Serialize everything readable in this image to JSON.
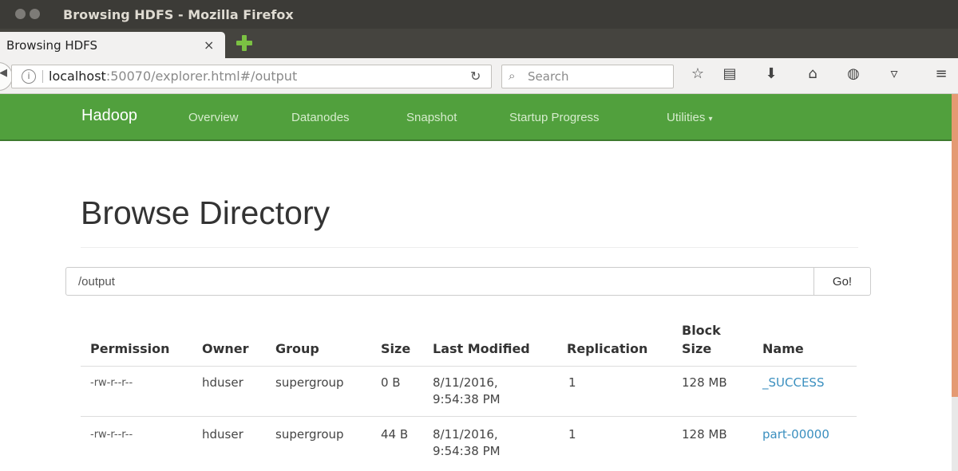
{
  "window": {
    "title": "Browsing HDFS - Mozilla Firefox"
  },
  "tab": {
    "label": "Browsing HDFS",
    "close": "×"
  },
  "navbar": {
    "url_host": "localhost",
    "url_rest": ":50070/explorer.html#/output",
    "search_placeholder": "Search"
  },
  "toolbar_icons": [
    "bookmark-star-icon",
    "reading-list-icon",
    "download-icon",
    "home-icon",
    "chat-icon",
    "pocket-icon",
    "menu-icon"
  ],
  "hadoop_nav": {
    "brand": "Hadoop",
    "links": [
      "Overview",
      "Datanodes",
      "Snapshot",
      "Startup Progress",
      "Utilities"
    ]
  },
  "main": {
    "title": "Browse Directory",
    "path_value": "/output",
    "go_label": "Go!",
    "columns": {
      "permission": "Permission",
      "owner": "Owner",
      "group": "Group",
      "size": "Size",
      "last_modified": "Last Modified",
      "replication": "Replication",
      "block_size_1": "Block",
      "block_size_2": "Size",
      "name": "Name"
    },
    "rows": [
      {
        "permission": "-rw-r--r--",
        "owner": "hduser",
        "group": "supergroup",
        "size": "0 B",
        "date": "8/11/2016,",
        "time": "9:54:38 PM",
        "replication": "1",
        "block_size": "128 MB",
        "name": "_SUCCESS"
      },
      {
        "permission": "-rw-r--r--",
        "owner": "hduser",
        "group": "supergroup",
        "size": "44 B",
        "date": "8/11/2016,",
        "time": "9:54:38 PM",
        "replication": "1",
        "block_size": "128 MB",
        "name": "part-00000"
      }
    ]
  },
  "colors": {
    "hadoop_green": "#51a03d",
    "link_blue": "#3a8fbf",
    "titlebar": "#3c3b37"
  }
}
